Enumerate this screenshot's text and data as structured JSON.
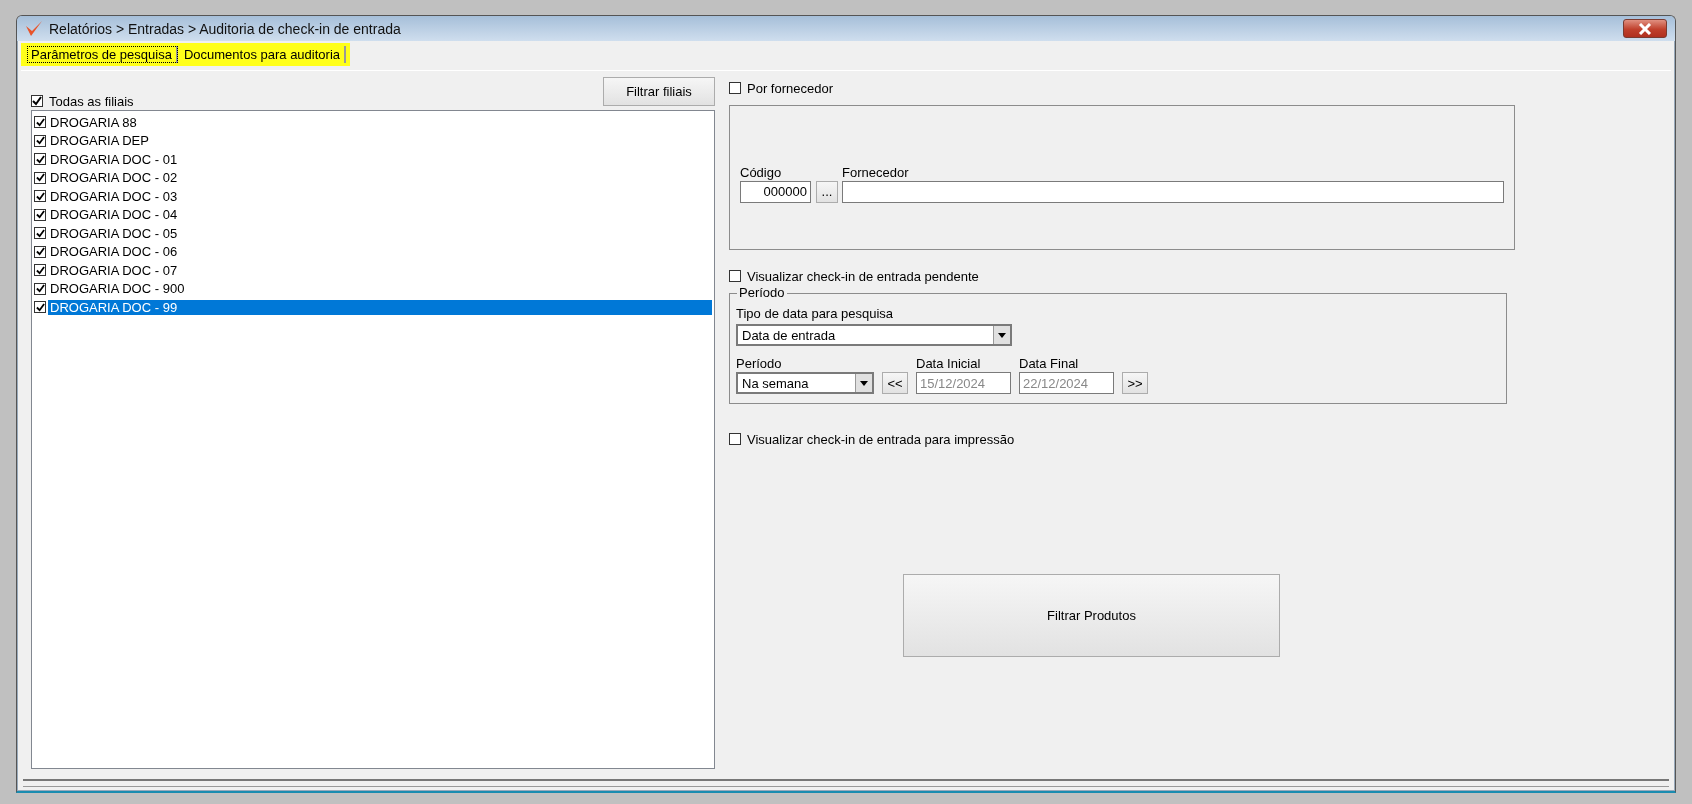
{
  "window": {
    "title": "Relatórios > Entradas > Auditoria de check-in de entrada"
  },
  "tabs": [
    {
      "label": "Parâmetros de pesquisa",
      "selected": true
    },
    {
      "label": "Documentos para auditoria",
      "selected": false
    }
  ],
  "branches": {
    "all": {
      "label": "Todas as filiais",
      "checked": true
    },
    "filter_button": "Filtrar filiais",
    "items": [
      {
        "label": "DROGARIA 88",
        "checked": true,
        "selected": false
      },
      {
        "label": "DROGARIA DEP",
        "checked": true,
        "selected": false
      },
      {
        "label": "DROGARIA DOC - 01",
        "checked": true,
        "selected": false
      },
      {
        "label": "DROGARIA DOC - 02",
        "checked": true,
        "selected": false
      },
      {
        "label": "DROGARIA DOC - 03",
        "checked": true,
        "selected": false
      },
      {
        "label": "DROGARIA DOC - 04",
        "checked": true,
        "selected": false
      },
      {
        "label": "DROGARIA DOC - 05",
        "checked": true,
        "selected": false
      },
      {
        "label": "DROGARIA DOC - 06",
        "checked": true,
        "selected": false
      },
      {
        "label": "DROGARIA DOC - 07",
        "checked": true,
        "selected": false
      },
      {
        "label": "DROGARIA DOC - 900",
        "checked": true,
        "selected": false
      },
      {
        "label": "DROGARIA DOC - 99",
        "checked": true,
        "selected": true
      }
    ]
  },
  "supplier": {
    "checkbox": {
      "label": "Por fornecedor",
      "checked": false
    },
    "code_label": "Código",
    "code_value": "000000",
    "lookup_button": "...",
    "name_label": "Fornecedor"
  },
  "pending": {
    "label": "Visualizar check-in de entrada pendente",
    "checked": false
  },
  "period": {
    "legend": "Período",
    "date_type_label": "Tipo de data para pesquisa",
    "date_type_value": "Data de entrada",
    "period_label": "Período",
    "period_value": "Na semana",
    "prev_button": "<<",
    "start_label": "Data Inicial",
    "start_value": "15/12/2024",
    "end_label": "Data Final",
    "end_value": "22/12/2024",
    "next_button": ">>"
  },
  "print": {
    "label": "Visualizar check-in de entrada para impressão",
    "checked": false
  },
  "filter_products_button": "Filtrar Produtos"
}
